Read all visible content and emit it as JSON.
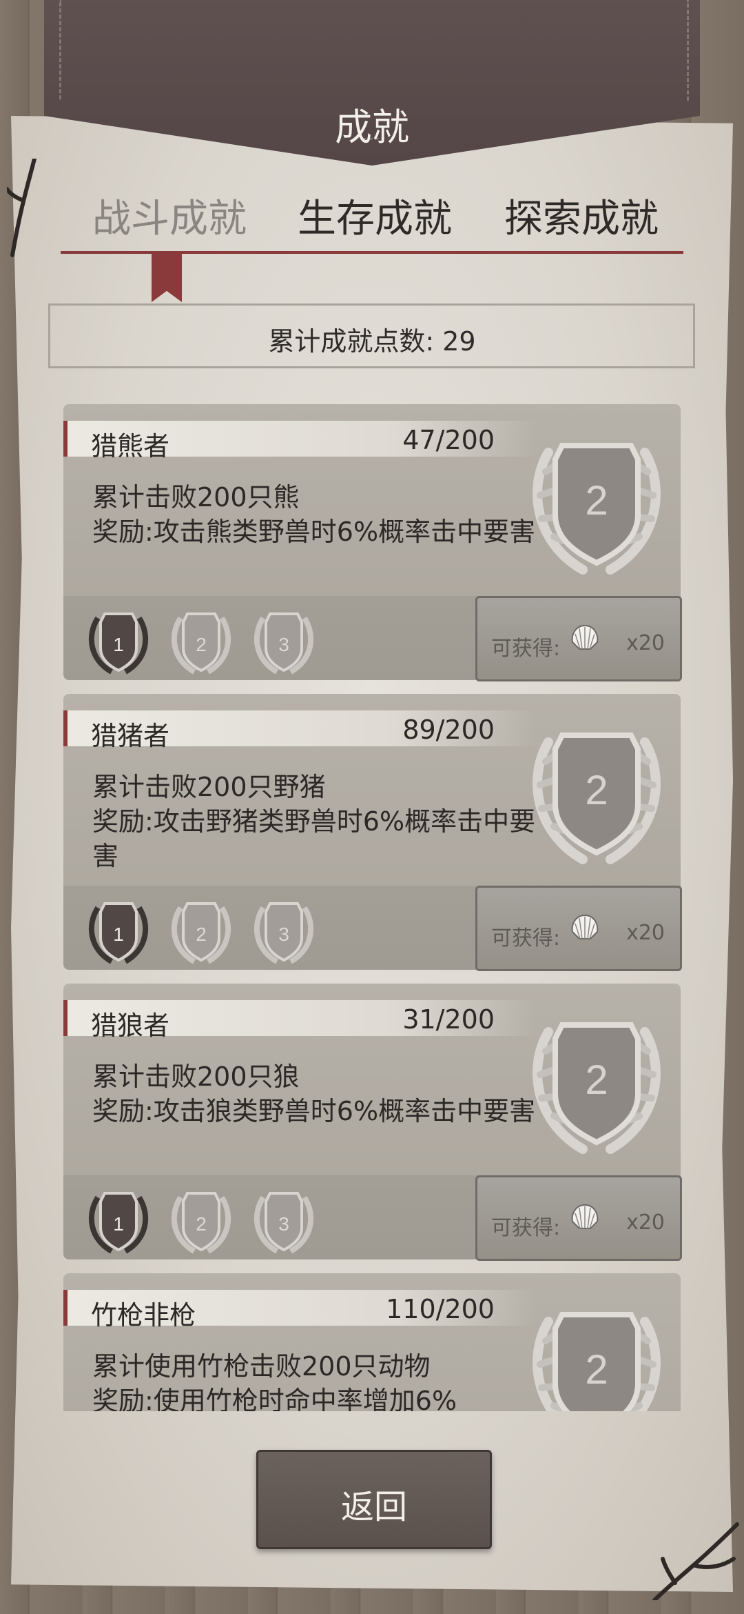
{
  "screen": {
    "title": "成就",
    "tabs": [
      {
        "label": "战斗成就",
        "active": true
      },
      {
        "label": "生存成就",
        "active": false
      },
      {
        "label": "探索成就",
        "active": false
      }
    ],
    "points_label": "累计成就点数: 29"
  },
  "achievements": [
    {
      "name": "猎熊者",
      "progress": "47/200",
      "desc_line1": "累计击败200只熊",
      "desc_line2": "奖励:攻击熊类野兽时6%概率击中要害",
      "badge_level": "2",
      "tiers": [
        "1",
        "2",
        "3"
      ],
      "claim_label": "可获得:",
      "claim_amount": "x20"
    },
    {
      "name": "猎猪者",
      "progress": "89/200",
      "desc_line1": "累计击败200只野猪",
      "desc_line2": "奖励:攻击野猪类野兽时6%概率击中要害",
      "badge_level": "2",
      "tiers": [
        "1",
        "2",
        "3"
      ],
      "claim_label": "可获得:",
      "claim_amount": "x20"
    },
    {
      "name": "猎狼者",
      "progress": "31/200",
      "desc_line1": "累计击败200只狼",
      "desc_line2": "奖励:攻击狼类野兽时6%概率击中要害",
      "badge_level": "2",
      "tiers": [
        "1",
        "2",
        "3"
      ],
      "claim_label": "可获得:",
      "claim_amount": "x20"
    },
    {
      "name": "竹枪非枪",
      "progress": "110/200",
      "desc_line1": "累计使用竹枪击败200只动物",
      "desc_line2": "奖励:使用竹枪时命中率增加6%",
      "badge_level": "2"
    }
  ],
  "icons": {
    "reward": "shell-icon",
    "badge": "laurel-shield-icon"
  },
  "colors": {
    "accent": "#8a3a3a",
    "banner": "#5a4c4b",
    "parchment": "#dcd7cf",
    "card": "#b1aba3"
  },
  "back_label": "返回"
}
